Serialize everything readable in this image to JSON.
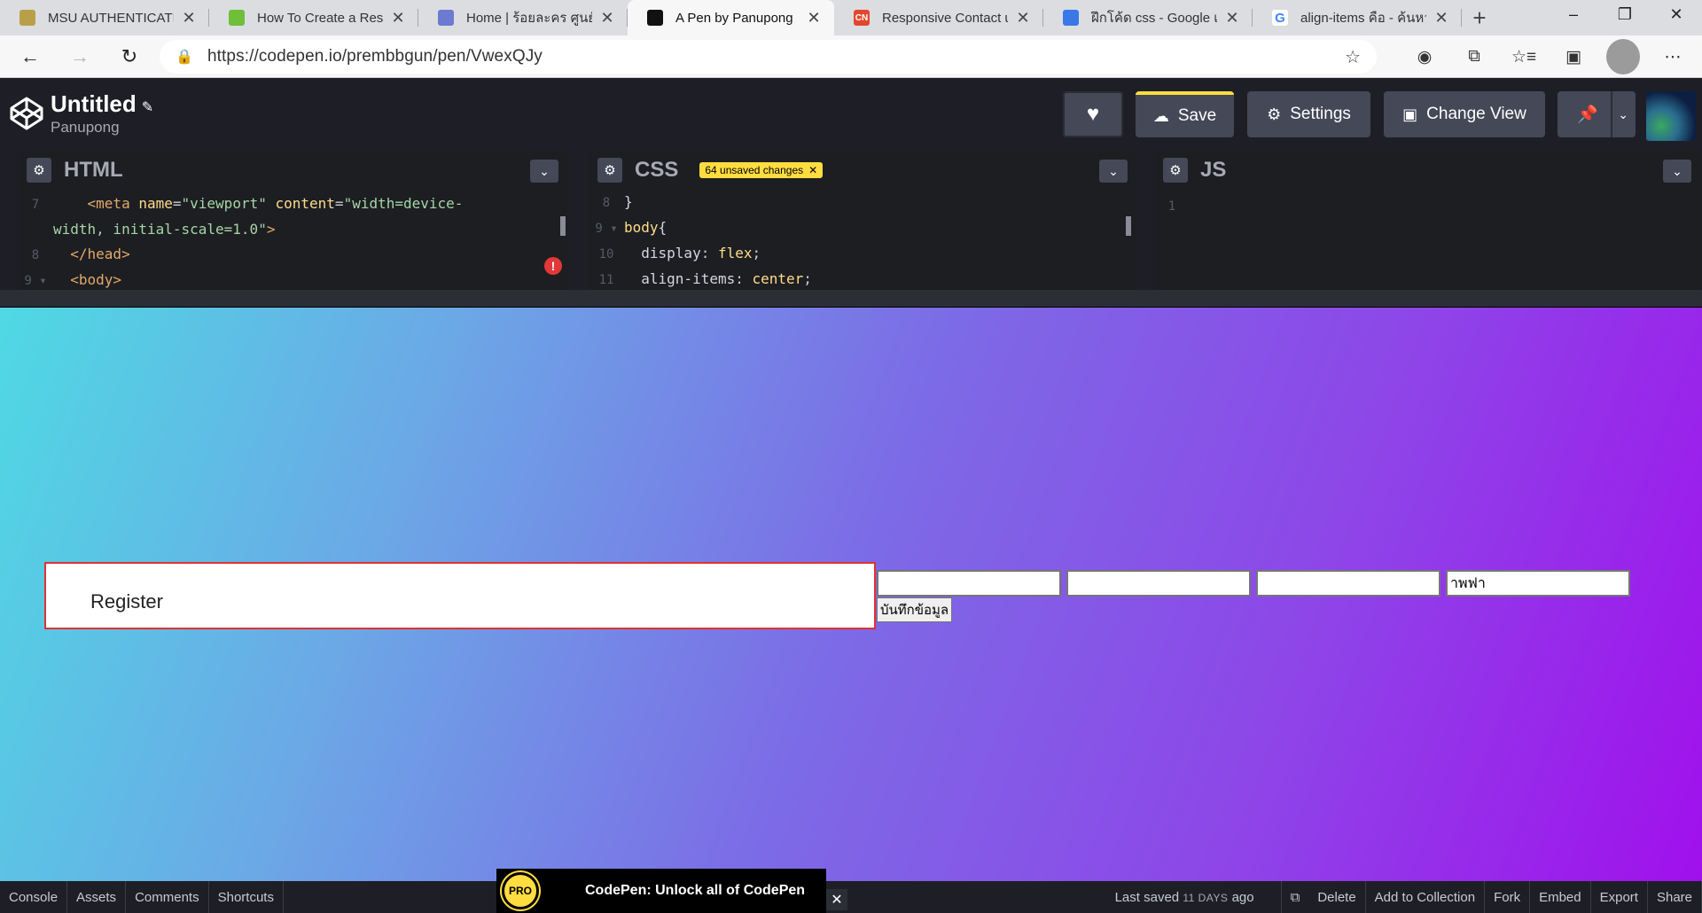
{
  "browser": {
    "tabs": [
      {
        "title": "MSU AUTHENTICATION",
        "favicon_color": "#b8a04a",
        "favicon_text": ""
      },
      {
        "title": "How To Create a Respo",
        "favicon_color": "#6fbf3a",
        "favicon_text": ""
      },
      {
        "title": "Home | ร้อยละคร ศูนย์รวม",
        "favicon_color": "#6c7bd1",
        "favicon_text": ""
      },
      {
        "title": "A Pen by Panupong",
        "favicon_color": "#111111",
        "favicon_text": ""
      },
      {
        "title": "Responsive Contact us",
        "favicon_color": "#e2472f",
        "favicon_text": "CN"
      },
      {
        "title": "ฝึกโค้ด css - Google เอก",
        "favicon_color": "#3b78e7",
        "favicon_text": ""
      },
      {
        "title": "align-items คือ - ค้นหาด้",
        "favicon_color": "#ffffff",
        "favicon_text": "G"
      }
    ],
    "url": "https://codepen.io/prembbgun/pen/VwexQJy"
  },
  "pen": {
    "title": "Untitled",
    "author": "Panupong",
    "save_label": "Save",
    "settings_label": "Settings",
    "change_view_label": "Change View"
  },
  "editors": {
    "html": {
      "label": "HTML",
      "lines": [
        {
          "num": "7",
          "html": "&nbsp;&nbsp;&nbsp;&nbsp;<span class='tag'>&lt;meta</span> <span class='attr'>name</span>=<span class='str'>\"viewport\"</span> <span class='attr'>content</span>=<span class='str'>\"width=device-</span>"
        },
        {
          "num": "",
          "html": "<span class='str'>width, initial-scale=1.0\"</span><span class='tag'>&gt;</span>"
        },
        {
          "num": "8",
          "html": "&nbsp;&nbsp;<span class='tag'>&lt;/head&gt;</span>"
        },
        {
          "num": "9 ▾",
          "html": "&nbsp;&nbsp;<span class='tag'>&lt;body&gt;</span>"
        }
      ]
    },
    "css": {
      "label": "CSS",
      "unsaved": "64 unsaved changes",
      "lines": [
        {
          "num": "8",
          "html": "<span class='prop'>}</span>"
        },
        {
          "num": "9 ▾",
          "html": "<span class='sel'>body</span><span class='prop'>{</span>"
        },
        {
          "num": "10",
          "html": "&nbsp;&nbsp;<span class='prop'>display</span>: <span class='val'>flex</span>;"
        },
        {
          "num": "11",
          "html": "&nbsp;&nbsp;<span class='prop'>align-items</span>: <span class='val'>center</span>;"
        }
      ]
    },
    "js": {
      "label": "JS",
      "lines": [
        {
          "num": "1",
          "html": ""
        }
      ]
    }
  },
  "preview": {
    "register_title": "Register",
    "fields": [
      "",
      "",
      "",
      "าพฟา"
    ],
    "submit_label": "บันทึกข้อมูล"
  },
  "footer": {
    "left": [
      "Console",
      "Assets",
      "Comments",
      "Shortcuts"
    ],
    "last_saved_prefix": "Last saved",
    "last_saved_time": "11 DAYS",
    "last_saved_suffix": "ago",
    "right": [
      "Delete",
      "Add to Collection",
      "Fork",
      "Embed",
      "Export",
      "Share"
    ],
    "promo_badge": "PRO",
    "promo_text": "CodePen: Unlock all of CodePen"
  }
}
